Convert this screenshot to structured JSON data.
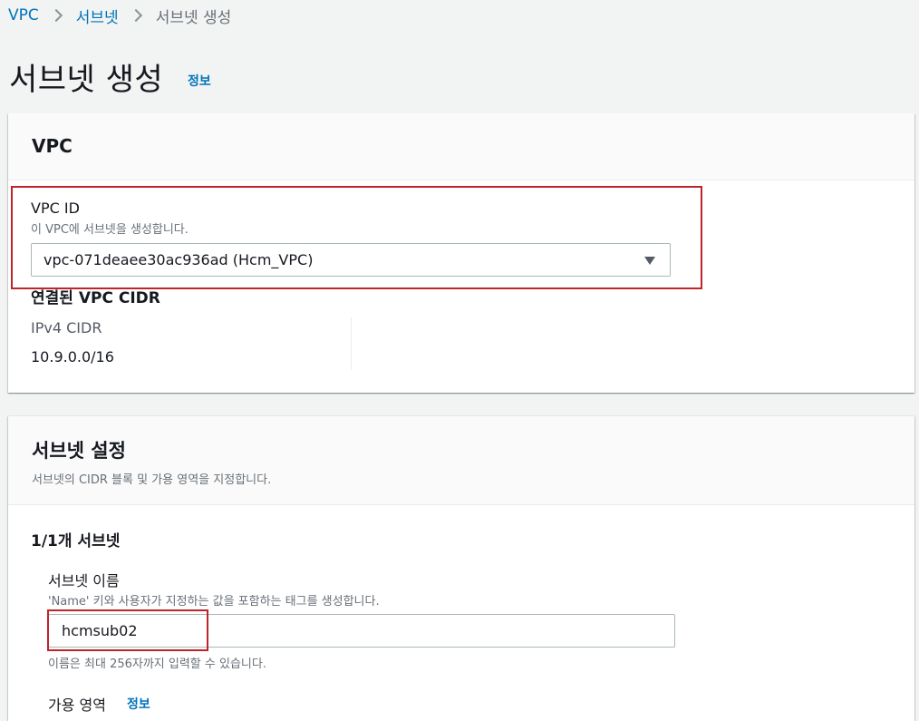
{
  "breadcrumb": {
    "items": [
      "VPC",
      "서브넷",
      "서브넷 생성"
    ]
  },
  "header": {
    "title": "서브넷 생성",
    "info": "정보"
  },
  "vpc_panel": {
    "title": "VPC",
    "vpc_id_label": "VPC ID",
    "vpc_id_desc": "이 VPC에 서브넷을 생성합니다.",
    "vpc_id_value": "vpc-071deaee30ac936ad (Hcm_VPC)",
    "cidr_heading": "연결된 VPC CIDR",
    "ipv4_label": "IPv4 CIDR",
    "ipv4_value": "10.9.0.0/16"
  },
  "subnet_panel": {
    "title": "서브넷 설정",
    "desc": "서브넷의 CIDR 블록 및 가용 영역을 지정합니다.",
    "count_heading": "1/1개 서브넷",
    "name_label": "서브넷 이름",
    "name_desc": "'Name' 키와 사용자가 지정하는 값을 포함하는 태그를 생성합니다.",
    "name_value": "hcmsub02",
    "name_hint": "이름은 최대 256자까지 입력할 수 있습니다.",
    "az_label": "가용 영역",
    "az_info": "정보"
  },
  "colors": {
    "link": "#0073bb",
    "highlight": "#c0242b",
    "background": "#f2f3f3"
  }
}
